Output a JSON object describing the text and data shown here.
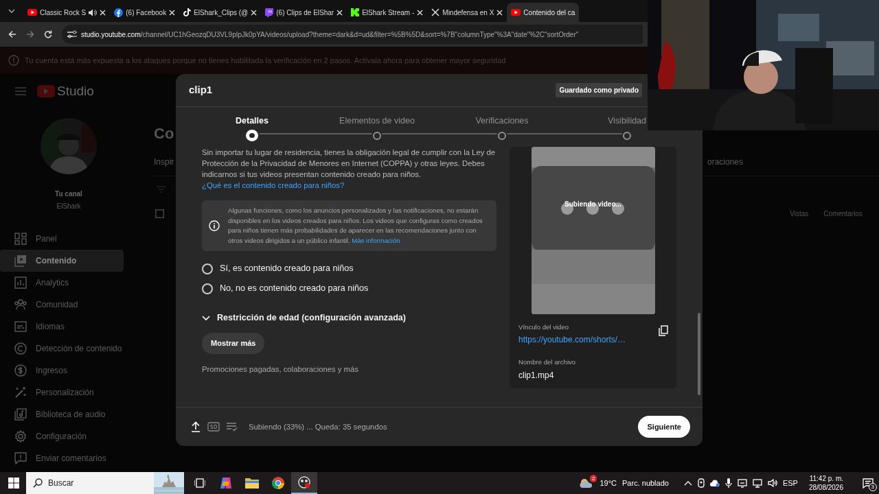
{
  "browser": {
    "tabs": [
      {
        "label": "Classic Rock S",
        "kind": "youtube",
        "audio": true,
        "selected": false
      },
      {
        "label": "(6) Facebook",
        "kind": "facebook",
        "audio": false,
        "selected": false
      },
      {
        "label": "ElShark_Clips (@",
        "kind": "tiktok",
        "audio": false,
        "selected": false
      },
      {
        "label": "(6) Clips de ElShar",
        "kind": "twitch",
        "audio": false,
        "selected": false
      },
      {
        "label": "ElShark Stream - ",
        "kind": "kick",
        "audio": false,
        "selected": false
      },
      {
        "label": "Mindefensa en X",
        "kind": "x",
        "audio": false,
        "selected": false
      },
      {
        "label": "Contenido del ca",
        "kind": "youtube",
        "audio": false,
        "selected": true
      }
    ],
    "url_host": "studio.youtube.com",
    "url_path": "/channel/UC1hGeozqDU3VL9pIpJk0pYA/videos/upload?theme=dark&d=ud&filter=%5B%5D&sort=%7B\"columnType\"%3A\"date\"%2C\"sortOrder\"",
    "banner": "Tu cuenta está más expuesta a los ataques porque no tienes habilitada la verificación en 2 pasos. Actívala ahora para obtener mayor seguridad"
  },
  "studio": {
    "logo": "Studio",
    "channel_label": "Tu canal",
    "channel_name": "ElShark",
    "nav": [
      {
        "label": "Panel",
        "kind": "dashboard",
        "selected": false
      },
      {
        "label": "Contenido",
        "kind": "content",
        "selected": true
      },
      {
        "label": "Analytics",
        "kind": "analytics",
        "selected": false
      },
      {
        "label": "Comunidad",
        "kind": "community",
        "selected": false
      },
      {
        "label": "Idiomas",
        "kind": "subtitles",
        "selected": false
      },
      {
        "label": "Detección de contenido",
        "kind": "copyright",
        "selected": false
      },
      {
        "label": "Ingresos",
        "kind": "money",
        "selected": false
      },
      {
        "label": "Personalización",
        "kind": "wand",
        "selected": false
      },
      {
        "label": "Biblioteca de audio",
        "kind": "audio",
        "selected": false
      },
      {
        "label": "Configuración",
        "kind": "gear",
        "selected": false
      },
      {
        "label": "Enviar comentarios",
        "kind": "feedback",
        "selected": false
      }
    ],
    "select_all_checked": false,
    "page_title": "Co",
    "tab_left": "Inspir",
    "tab_right": "oraciones",
    "columns": [
      "Vistas",
      "Comentarios"
    ]
  },
  "dialog": {
    "title": "clip1",
    "save_status": "Guardado como privado",
    "steps": [
      {
        "label": "Detalles",
        "selected": true
      },
      {
        "label": "Elementos de video",
        "selected": false
      },
      {
        "label": "Verificaciones",
        "selected": false
      },
      {
        "label": "Visibilidad",
        "selected": false
      }
    ],
    "audience_text": "Sin importar tu lugar de residencia, tienes la obligación legal de cumplir con la Ley de Protección de la Privacidad de Menores en Internet (COPPA) y otras leyes. Debes indicarnos si tus videos presentan contenido creado para niños.",
    "audience_link": "¿Qué es el contenido creado para niños?",
    "notice_text": "Algunas funciones, como los anuncios personalizados y las notificaciones, no estarán disponibles en los videos creados para niños. Los videos que configuras como creados para niños tienen más probabilidades de aparecer en las recomendaciones junto con otros videos dirigidos a un público infantil.",
    "notice_link": "Más información",
    "options": [
      {
        "label": "Sí, es contenido creado para niños",
        "selected": false
      },
      {
        "label": "No, no es contenido creado para niños",
        "selected": false
      }
    ],
    "section": {
      "label": "Restricción de edad (configuración avanzada)",
      "expanded": false
    },
    "show_more": "Mostrar más",
    "more_hint": "Promociones pagadas, colaboraciones y más",
    "preview": {
      "status": "Subiendo video...",
      "link_label": "Vínculo del video",
      "link": "https://youtube.com/shorts/…",
      "file_label": "Nombre del archivo",
      "file": "clip1.mp4"
    },
    "footer": {
      "status": "Subiendo (33%) ... Queda: 35 segundos",
      "next": "Siguiente"
    }
  },
  "taskbar": {
    "search": "Buscar",
    "apps": [
      {
        "kind": "taskview",
        "selected": false
      },
      {
        "kind": "copilot",
        "selected": false
      },
      {
        "kind": "folder",
        "selected": false
      },
      {
        "kind": "chrome",
        "selected": false
      },
      {
        "kind": "recorder",
        "selected": true
      }
    ],
    "weather_badge": "2",
    "temperature": "19°C",
    "condition": "Parc. nublado",
    "language": "ESP",
    "time": "11:42 p. m.",
    "date": "28/08/2026",
    "notifications": "3"
  }
}
